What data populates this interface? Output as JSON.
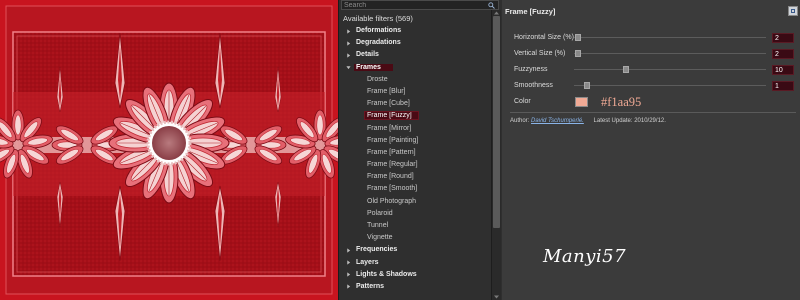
{
  "search": {
    "placeholder": "Search"
  },
  "tree": {
    "header": "Available filters (569)",
    "items": [
      {
        "label": "Deformations",
        "type": "category",
        "expanded": false
      },
      {
        "label": "Degradations",
        "type": "category",
        "expanded": false
      },
      {
        "label": "Details",
        "type": "category",
        "expanded": false
      },
      {
        "label": "Frames",
        "type": "category",
        "expanded": true,
        "selected": true
      },
      {
        "label": "Droste",
        "type": "filter"
      },
      {
        "label": "Frame [Blur]",
        "type": "filter"
      },
      {
        "label": "Frame [Cube]",
        "type": "filter"
      },
      {
        "label": "Frame [Fuzzy]",
        "type": "filter",
        "selected": true
      },
      {
        "label": "Frame [Mirror]",
        "type": "filter"
      },
      {
        "label": "Frame [Painting]",
        "type": "filter"
      },
      {
        "label": "Frame [Pattern]",
        "type": "filter"
      },
      {
        "label": "Frame [Regular]",
        "type": "filter"
      },
      {
        "label": "Frame [Round]",
        "type": "filter"
      },
      {
        "label": "Frame [Smooth]",
        "type": "filter"
      },
      {
        "label": "Old Photograph",
        "type": "filter"
      },
      {
        "label": "Polaroid",
        "type": "filter"
      },
      {
        "label": "Tunnel",
        "type": "filter"
      },
      {
        "label": "Vignette",
        "type": "filter"
      },
      {
        "label": "Frequencies",
        "type": "category",
        "expanded": false
      },
      {
        "label": "Layers",
        "type": "category",
        "expanded": false
      },
      {
        "label": "Lights & Shadows",
        "type": "category",
        "expanded": false
      },
      {
        "label": "Patterns",
        "type": "category",
        "expanded": false
      }
    ]
  },
  "settings": {
    "title": "Frame [Fuzzy]",
    "params": [
      {
        "label": "Horizontal Size (%)",
        "value": "2",
        "level": 0.02
      },
      {
        "label": "Vertical Size (%)",
        "value": "2",
        "level": 0.02
      },
      {
        "label": "Fuzzyness",
        "value": "10",
        "level": 0.27
      },
      {
        "label": "Smoothness",
        "value": "1",
        "level": 0.07
      }
    ],
    "color": {
      "label": "Color",
      "value": "#f1aa95"
    },
    "author_label": "Author:",
    "author_name": "David Tschumperlé.",
    "update": "Latest Update: 2010/29/12."
  },
  "signature": "Manyi57",
  "colors": {
    "accent": "#f1aa95",
    "selection": "#4a0a14",
    "preview_bg": "#b3121c"
  }
}
